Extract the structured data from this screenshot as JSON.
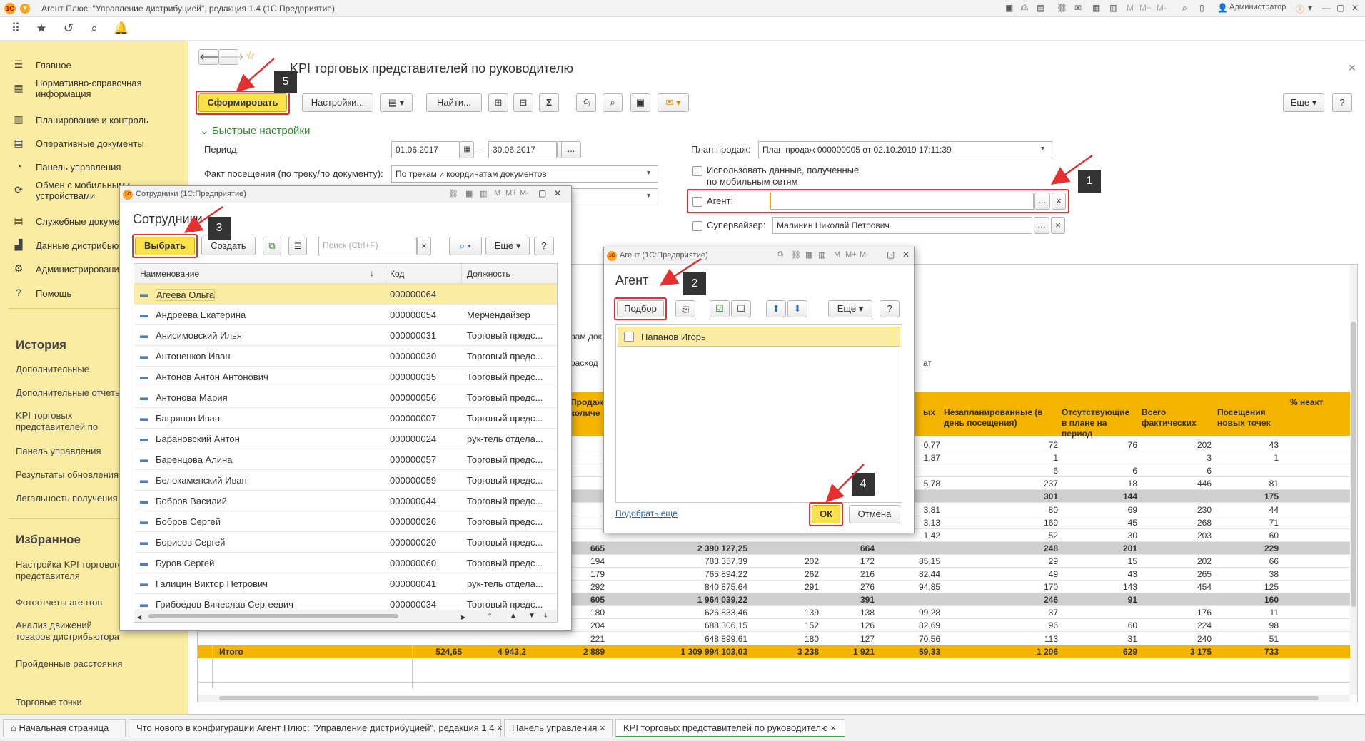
{
  "window": {
    "title": "Агент Плюс: \"Управление дистрибуцией\", редакция 1.4  (1С:Предприятие)",
    "user": "Администратор"
  },
  "toolbar_icons": [
    "apps-icon",
    "star-icon",
    "history-icon",
    "search-icon",
    "bell-icon"
  ],
  "sidebar": {
    "items": [
      {
        "label": "Главное",
        "icon": "menu-icon"
      },
      {
        "label": "Нормативно-справочная информация",
        "icon": "table-icon"
      },
      {
        "label": "Планирование и контроль",
        "icon": "bars-icon"
      },
      {
        "label": "Оперативные документы",
        "icon": "doc-icon"
      },
      {
        "label": "Панель управления",
        "icon": "gauge-icon"
      },
      {
        "label": "Обмен с мобильными устройствами",
        "icon": "sync-icon"
      },
      {
        "label": "Служебные документы",
        "icon": "doc-icon"
      },
      {
        "label": "Данные дистрибьюторов",
        "icon": "chart-icon"
      },
      {
        "label": "Администрирование",
        "icon": "gear-icon"
      },
      {
        "label": "Помощь",
        "icon": "help-icon"
      }
    ],
    "history_title": "История",
    "history": [
      "Дополнительные обработки",
      "Дополнительные отчеты",
      "KPI торговых представителей по руководителю",
      "Панель управления",
      "Результаты обновления",
      "Легальность получения"
    ],
    "favorites_title": "Избранное",
    "favorites": [
      "Настройка KPI торгового представителя",
      "Фотоотчеты агентов",
      "Анализ движений товаров дистрибьютора",
      "Пройденные расстояния агентов",
      "Торговые точки"
    ]
  },
  "report": {
    "title": "KPI торговых представителей по руководителю",
    "btn_generate": "Сформировать",
    "btn_settings": "Настройки...",
    "btn_find": "Найти...",
    "btn_more": "Еще",
    "btn_help": "?",
    "quick_settings": "Быстрые настройки",
    "period_label": "Период:",
    "date_from": "01.06.2017",
    "dash": "–",
    "date_to": "30.06.2017",
    "ellipsis": "...",
    "fact_label": "Факт посещения (по треку/по документу):",
    "fact_value": "По трекам и координатам документов",
    "plan_label": "План продаж:",
    "plan_value": "План продаж 000000005 от 02.10.2019 17:11:39",
    "mobile_label": "Использовать данные, полученные по мобильным сетям",
    "agent_label": "Агент:",
    "supervisor_label": "Супервайзер:",
    "supervisor_value": "Малинин Николай Петрович",
    "clear": "×",
    "partial_texts": [
      "рам док",
      "расход",
      "ат"
    ],
    "headers": [
      "Продаж количе",
      "ых",
      "Незапланированные (в день посещения)",
      "Отсутствующие в плане на период",
      "Всего фактических",
      "Посещения новых точек",
      "% неакт"
    ],
    "rows": [
      {
        "bold": false,
        "cells": [
          "",
          "",
          "",
          "",
          "",
          "",
          "0,77",
          "72",
          "76",
          "202",
          "43"
        ]
      },
      {
        "bold": false,
        "cells": [
          "",
          "",
          "",
          "",
          "",
          "",
          "1,87",
          "1",
          "",
          "3",
          "1"
        ]
      },
      {
        "bold": false,
        "cells": [
          "",
          "",
          "",
          "",
          "",
          "",
          "",
          "6",
          "6",
          "6",
          ""
        ]
      },
      {
        "bold": false,
        "cells": [
          "",
          "",
          "",
          "",
          "",
          "",
          "5,78",
          "237",
          "18",
          "446",
          "81"
        ]
      },
      {
        "bold": true,
        "cells": [
          "",
          "",
          "",
          "",
          "",
          "",
          "",
          "301",
          "144",
          "",
          "175"
        ]
      },
      {
        "bold": false,
        "cells": [
          "",
          "",
          "",
          "",
          "",
          "",
          "3,81",
          "80",
          "69",
          "230",
          "44"
        ]
      },
      {
        "bold": false,
        "cells": [
          "",
          "",
          "",
          "",
          "",
          "",
          "3,13",
          "169",
          "45",
          "268",
          "71"
        ]
      },
      {
        "bold": false,
        "cells": [
          "",
          "",
          "",
          "",
          "",
          "",
          "1,42",
          "52",
          "30",
          "203",
          "60"
        ]
      },
      {
        "bold": true,
        "cells": [
          "",
          "",
          "665",
          "2 390 127,25",
          "",
          "664",
          "",
          "248",
          "201",
          "",
          "229"
        ]
      },
      {
        "bold": false,
        "cells": [
          "",
          "",
          "194",
          "783 357,39",
          "202",
          "172",
          "85,15",
          "29",
          "15",
          "202",
          "66"
        ]
      },
      {
        "bold": false,
        "cells": [
          "",
          "",
          "179",
          "765 894,22",
          "262",
          "216",
          "82,44",
          "49",
          "43",
          "265",
          "38"
        ]
      },
      {
        "bold": false,
        "cells": [
          "",
          "",
          "292",
          "840 875,64",
          "291",
          "276",
          "94,85",
          "170",
          "143",
          "454",
          "125"
        ]
      },
      {
        "bold": true,
        "cells": [
          "",
          "",
          "605",
          "1 964 039,22",
          "",
          "391",
          "",
          "246",
          "91",
          "",
          "160"
        ]
      },
      {
        "bold": false,
        "cells": [
          "",
          "",
          "180",
          "626 833,46",
          "139",
          "138",
          "99,28",
          "37",
          "",
          "176",
          "11"
        ]
      },
      {
        "bold": false,
        "cells": [
          "",
          "",
          "204",
          "688 306,15",
          "152",
          "126",
          "82,69",
          "96",
          "60",
          "224",
          "98"
        ]
      },
      {
        "bold": false,
        "cells": [
          "",
          "",
          "221",
          "648 899,61",
          "180",
          "127",
          "70,56",
          "113",
          "31",
          "240",
          "51"
        ]
      }
    ],
    "total": {
      "label": "Итого",
      "cells": [
        "524,65",
        "4 943,2",
        "2 889",
        "1 309 994 103,03",
        "3 238",
        "1 921",
        "59,33",
        "1 206",
        "629",
        "3 175",
        "733"
      ]
    }
  },
  "employees_dialog": {
    "window_title": "Сотрудники  (1С:Предприятие)",
    "heading": "Сотрудники",
    "btn_select": "Выбрать",
    "btn_create": "Создать",
    "search_placeholder": "Поиск (Ctrl+F)",
    "btn_more": "Еще",
    "btn_help": "?",
    "columns": [
      "Наименование",
      "Код",
      "Должность"
    ],
    "rows": [
      [
        "Агеева Ольга",
        "000000064",
        ""
      ],
      [
        "Андреева Екатерина",
        "000000054",
        "Мерчендайзер"
      ],
      [
        "Анисимовский Илья",
        "000000031",
        "Торговый предс..."
      ],
      [
        "Антоненков Иван",
        "000000030",
        "Торговый предс..."
      ],
      [
        "Антонов Антон Антонович",
        "000000035",
        "Торговый предс..."
      ],
      [
        "Антонова Мария",
        "000000056",
        "Торговый предс..."
      ],
      [
        "Багрянов Иван",
        "000000007",
        "Торговый предс..."
      ],
      [
        "Барановский Антон",
        "000000024",
        "рук-тель отдела..."
      ],
      [
        "Баренцова Алина",
        "000000057",
        "Торговый предс..."
      ],
      [
        "Белокаменский Иван",
        "000000059",
        "Торговый предс..."
      ],
      [
        "Бобров Василий",
        "000000044",
        "Торговый предс..."
      ],
      [
        "Бобров Сергей",
        "000000026",
        "Торговый предс..."
      ],
      [
        "Борисов Сергей",
        "000000020",
        "Торговый предс..."
      ],
      [
        "Буров Сергей",
        "000000060",
        "Торговый предс..."
      ],
      [
        "Галицин Виктор Петрович",
        "000000041",
        "рук-тель отдела..."
      ],
      [
        "Грибоедов Вячеслав Сергеевич",
        "000000034",
        "Торговый предс..."
      ]
    ]
  },
  "agent_dialog": {
    "window_title": "Агент  (1С:Предприятие)",
    "heading": "Агент",
    "btn_pick": "Подбор",
    "btn_more": "Еще",
    "btn_help": "?",
    "items": [
      "Папанов Игорь"
    ],
    "link_more": "Подобрать еще",
    "btn_ok": "ОК",
    "btn_cancel": "Отмена"
  },
  "badges": [
    "1",
    "2",
    "3",
    "4",
    "5"
  ],
  "tabs": [
    "Начальная страница",
    "Что нового в конфигурации Агент Плюс: \"Управление дистрибуцией\", редакция 1.4",
    "Панель управления",
    "KPI торговых представителей по руководителю"
  ]
}
